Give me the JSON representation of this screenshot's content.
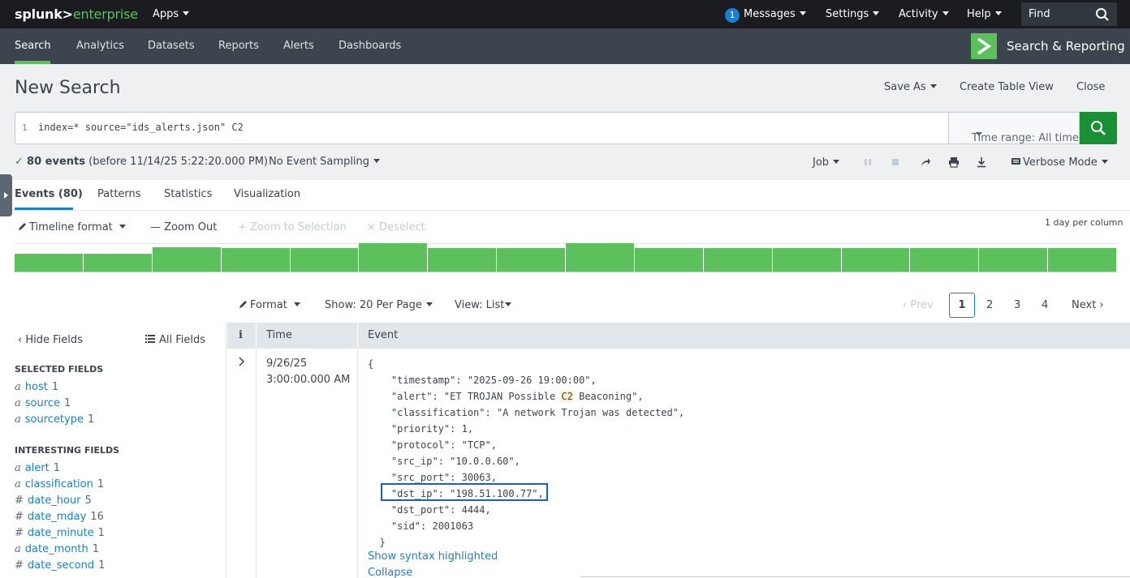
{
  "topbar": {
    "logo_part1": "splunk>",
    "logo_part2": "enterprise",
    "apps_label": "Apps",
    "messages_count": "1",
    "messages_label": "Messages",
    "settings_label": "Settings",
    "activity_label": "Activity",
    "help_label": "Help",
    "find_placeholder": "Find"
  },
  "nav": {
    "items": [
      "Search",
      "Analytics",
      "Datasets",
      "Reports",
      "Alerts",
      "Dashboards"
    ],
    "active": "Search",
    "app_title": "Search & Reporting"
  },
  "header": {
    "title": "New Search",
    "save_as": "Save As",
    "create_table_view": "Create Table View",
    "close": "Close"
  },
  "search": {
    "line_number": "1",
    "query": "index=* source=\"ids_alerts.json\" C2",
    "time_range": "Time range: All time"
  },
  "status": {
    "check": "✓",
    "events_count": "80 events",
    "before": "(before 11/14/25 5:22:20.000 PM)",
    "sampling": "No Event Sampling",
    "job": "Job",
    "mode": "Verbose Mode"
  },
  "tabs": [
    "Events (80)",
    "Patterns",
    "Statistics",
    "Visualization"
  ],
  "timeline": {
    "format": "Timeline format",
    "zoom_out": "Zoom Out",
    "zoom_selection": "+ Zoom to Selection",
    "deselect": "× Deselect",
    "per_column": "1 day per column",
    "bar_levels": [
      0.64,
      0.64,
      0.86,
      0.82,
      0.82,
      1.0,
      0.82,
      0.82,
      1.0,
      0.82,
      0.82,
      0.82,
      0.82,
      0.82,
      0.82,
      0.82
    ]
  },
  "results_toolbar": {
    "format": "Format",
    "show": "Show: 20 Per Page",
    "view": "View: List",
    "prev": "Prev",
    "pages": [
      "1",
      "2",
      "3",
      "4"
    ],
    "next": "Next"
  },
  "sidebar": {
    "hide_fields": "Hide Fields",
    "all_fields": "All Fields",
    "selected_heading": "SELECTED FIELDS",
    "selected": [
      {
        "type": "a",
        "name": "host",
        "count": "1"
      },
      {
        "type": "a",
        "name": "source",
        "count": "1"
      },
      {
        "type": "a",
        "name": "sourcetype",
        "count": "1"
      }
    ],
    "interesting_heading": "INTERESTING FIELDS",
    "interesting": [
      {
        "type": "a",
        "name": "alert",
        "count": "1"
      },
      {
        "type": "a",
        "name": "classification",
        "count": "1"
      },
      {
        "type": "#",
        "name": "date_hour",
        "count": "5"
      },
      {
        "type": "#",
        "name": "date_mday",
        "count": "16"
      },
      {
        "type": "#",
        "name": "date_minute",
        "count": "1"
      },
      {
        "type": "a",
        "name": "date_month",
        "count": "1"
      },
      {
        "type": "#",
        "name": "date_second",
        "count": "1"
      }
    ]
  },
  "table": {
    "col_info": "i",
    "col_time": "Time",
    "col_event": "Event",
    "event": {
      "date": "9/26/25",
      "time": "3:00:00.000 AM",
      "lines": [
        "{",
        "    \"timestamp\": \"2025-09-26 19:00:00\",",
        "    \"alert\": \"ET TROJAN Possible |C2| Beaconing\",",
        "    \"classification\": \"A network Trojan was detected\",",
        "    \"priority\": 1,",
        "    \"protocol\": \"TCP\",",
        "    \"src_ip\": \"10.0.0.60\",",
        "    \"src_port\": 30063,",
        "    \"dst_ip\": \"198.51.100.77\",",
        "    \"dst_port\": 4444,",
        "    \"sid\": 2001063",
        "  }"
      ],
      "show_syntax": "Show syntax highlighted",
      "collapse": "Collapse"
    }
  }
}
